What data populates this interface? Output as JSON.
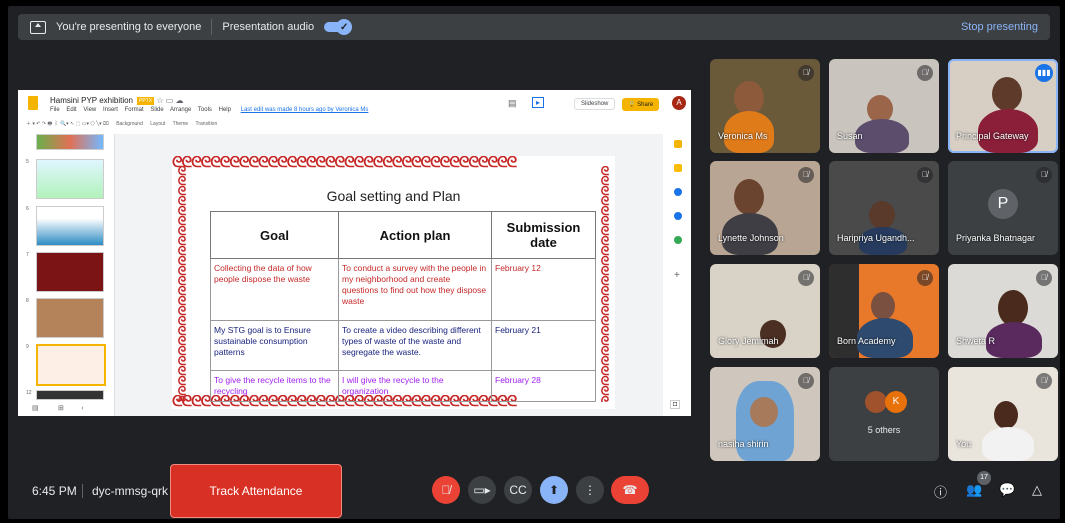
{
  "topbar": {
    "presenting_text": "You're presenting to everyone",
    "audio_label": "Presentation audio",
    "stop_label": "Stop presenting"
  },
  "slides_app": {
    "doc_title": "Hamsini PYP exhibition",
    "file_badge": "PPTX",
    "menu": [
      "File",
      "Edit",
      "View",
      "Insert",
      "Format",
      "Slide",
      "Arrange",
      "Tools",
      "Help"
    ],
    "last_edit": "Last edit was made 8 hours ago by Veronica Ms",
    "slideshow_label": "Slideshow",
    "share_label": "Share",
    "user_initial": "A",
    "toolbar_items": [
      "Background",
      "Layout",
      "Theme",
      "Transition"
    ],
    "thumb_numbers": [
      "5",
      "6",
      "7",
      "8",
      "9",
      "12"
    ]
  },
  "slide": {
    "title": "Goal setting and Plan",
    "headers": [
      "Goal",
      "Action plan",
      "Submission date"
    ],
    "rows": [
      {
        "goal": "Collecting the data of how people dispose the waste",
        "action": "To conduct a survey with the people in my neighborhood and create questions to find out how they dispose waste",
        "date": "February 12"
      },
      {
        "goal": "My STG goal is to Ensure sustainable consumption patterns",
        "action": "To create a video describing different types of waste of the waste and segregate the waste.",
        "date": "February 21"
      },
      {
        "goal": "To give the recycle items to the recycling",
        "action": "I will give the recycle to the organization",
        "date": "February 28"
      }
    ]
  },
  "participants": [
    {
      "name": "Veronica Ms"
    },
    {
      "name": "Susan"
    },
    {
      "name": "Principal Gateway"
    },
    {
      "name": "Lynette Johnson"
    },
    {
      "name": "Haripriya Ugandh..."
    },
    {
      "name": "Priyanka Bhatnagar",
      "initial": "P"
    },
    {
      "name": "Glory Jemimah"
    },
    {
      "name": "Born Academy"
    },
    {
      "name": "Shweta R"
    },
    {
      "name": "nasiha shirin"
    },
    {
      "name": "5 others",
      "initial": "K"
    },
    {
      "name": "You"
    }
  ],
  "bottombar": {
    "time": "6:45 PM",
    "meeting_code": "dyc-mmsg-qrk",
    "track_label": "Track Attendance",
    "people_count": "17"
  },
  "colors": {
    "bg": "#202124",
    "accent": "#8ab4f8",
    "danger": "#ea4335"
  }
}
